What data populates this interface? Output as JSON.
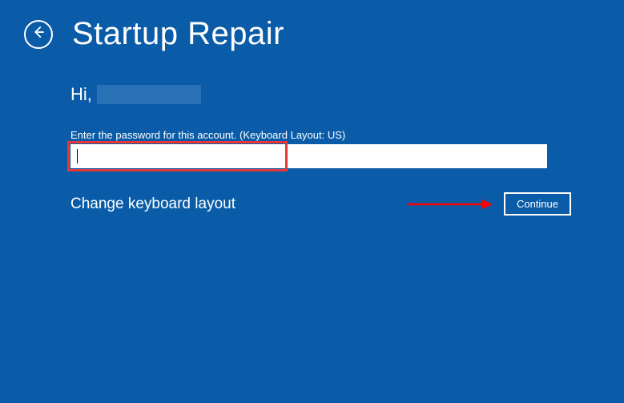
{
  "header": {
    "title": "Startup Repair"
  },
  "greeting": {
    "prefix": "Hi,",
    "username": ""
  },
  "password": {
    "label": "Enter the password for this account. (Keyboard Layout: US)",
    "value": ""
  },
  "layout_link": "Change keyboard layout",
  "continue_button": "Continue",
  "colors": {
    "background": "#0a5ca8",
    "highlight": "#e63838",
    "arrow": "#ff0000"
  }
}
